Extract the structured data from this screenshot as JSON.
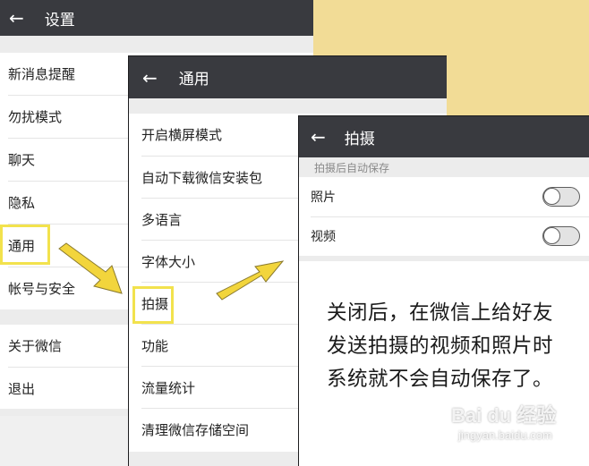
{
  "colors": {
    "titlebar": "#393a3f",
    "highlight": "#f2e24d",
    "yellow_bg": "#f2dc96",
    "arrow": "#f2d53c"
  },
  "panel_settings": {
    "back_icon": "arrow-left-icon",
    "title": "设置",
    "group1": [
      "新消息提醒",
      "勿扰模式",
      "聊天",
      "隐私",
      "通用",
      "帐号与安全"
    ],
    "group2": [
      "关于微信",
      "退出"
    ]
  },
  "panel_general": {
    "back_icon": "arrow-left-icon",
    "title": "通用",
    "items": [
      "开启横屏模式",
      "自动下载微信安装包",
      "多语言",
      "字体大小",
      "拍摄",
      "功能",
      "流量统计",
      "清理微信存储空间"
    ]
  },
  "panel_capture": {
    "back_icon": "arrow-left-icon",
    "title": "拍摄",
    "section_header": "拍摄后自动保存",
    "items": [
      {
        "label": "照片",
        "toggle_on": false
      },
      {
        "label": "视频",
        "toggle_on": false
      }
    ],
    "note_lines": [
      "关闭后，在微信上给好友",
      "发送拍摄的视频和照片时",
      "系统就不会自动保存了。"
    ]
  },
  "watermark": {
    "main": "Bai du 经验",
    "sub": "jingyan.baidu.com"
  }
}
